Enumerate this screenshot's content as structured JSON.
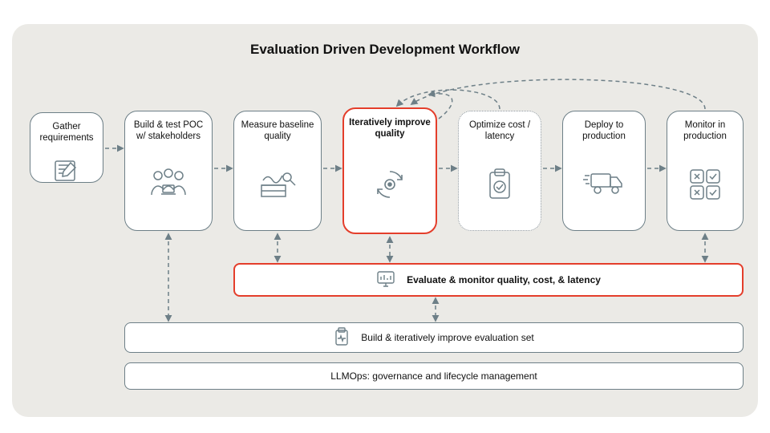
{
  "title": "Evaluation Driven Development Workflow",
  "steps": {
    "gather": "Gather requirements",
    "build_poc": "Build & test POC w/ stakeholders",
    "measure": "Measure baseline quality",
    "iterate": "Iteratively improve quality",
    "optimize": "Optimize cost / latency",
    "deploy": "Deploy to production",
    "monitor": "Monitor in production"
  },
  "bars": {
    "evaluate": "Evaluate & monitor quality, cost, & latency",
    "evalset": "Build & iteratively improve evaluation set",
    "llmops": "LLMOps: governance and lifecycle management"
  }
}
